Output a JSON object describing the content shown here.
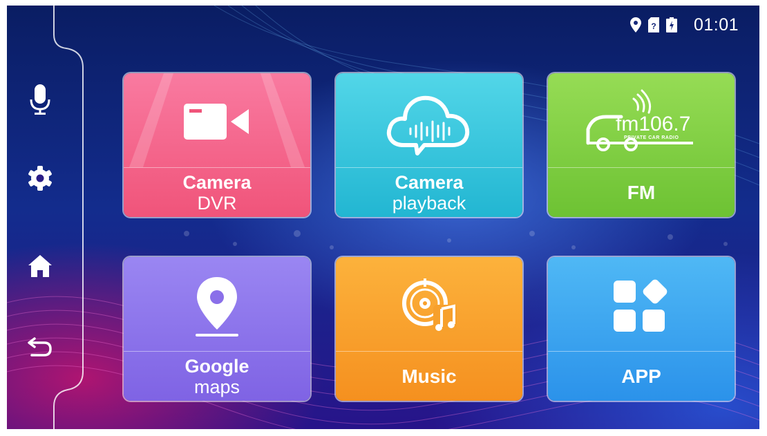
{
  "status_bar": {
    "time": "01:01",
    "icons": [
      "location-icon",
      "sim-card-icon",
      "battery-icon"
    ]
  },
  "sidebar": {
    "items": [
      {
        "name": "microphone-icon",
        "action": "voice"
      },
      {
        "name": "gear-icon",
        "action": "settings"
      },
      {
        "name": "home-icon",
        "action": "home"
      },
      {
        "name": "back-icon",
        "action": "back"
      }
    ]
  },
  "tiles": {
    "camera_dvr": {
      "line1": "Camera",
      "line2": "DVR",
      "color": "#f0547a",
      "icon": "video-camera-icon"
    },
    "camera_playback": {
      "line1": "Camera",
      "line2": "playback",
      "color": "#22b6d2",
      "icon": "cloud-audio-icon"
    },
    "fm": {
      "label": "FM",
      "logo_text": "fm106.7",
      "logo_subtext": "PRIVATE CAR RADIO",
      "color": "#6dc233",
      "icon": "fm-radio-logo"
    },
    "google_maps": {
      "line1": "Google",
      "line2": "maps",
      "color": "#7f63e4",
      "icon": "map-pin-icon"
    },
    "music": {
      "label": "Music",
      "color": "#f5901f",
      "icon": "music-disc-icon"
    },
    "app": {
      "label": "APP",
      "color": "#2b92ea",
      "icon": "apps-grid-icon"
    }
  }
}
